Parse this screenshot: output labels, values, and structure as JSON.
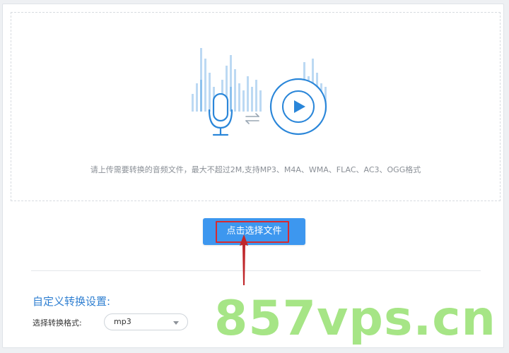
{
  "upload": {
    "hint": "请上传需要转换的音频文件，最大不超过2M,支持MP3、M4A、WMA、FLAC、AC3、OGG格式",
    "button_label": "点击选择文件"
  },
  "settings": {
    "title": "自定义转换设置:",
    "format_label": "选择转换格式:",
    "format_value": "mp3"
  },
  "watermark": "857vps.cn",
  "colors": {
    "accent": "#3d97ef",
    "title_blue": "#2f7fd1",
    "highlight_red": "#d82a2f",
    "watermark_green": "#9fe37c"
  },
  "icons": [
    "microphone-icon",
    "swap-arrows-icon",
    "play-disc-icon",
    "dropdown-caret-icon",
    "pointer-arrow"
  ]
}
